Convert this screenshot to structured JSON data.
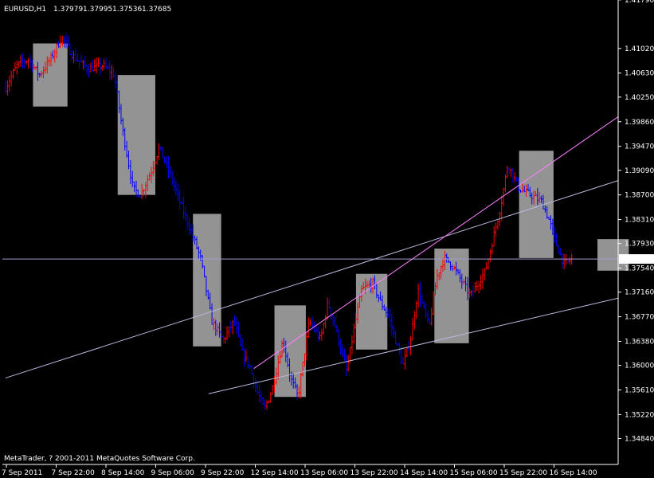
{
  "header": {
    "symbol": "EURUSD,H1",
    "open": "1.37979",
    "high": "1.37995",
    "low": "1.37536",
    "close": "1.37685"
  },
  "footer": {
    "copyright": "MetaTrader, ? 2001-2011 MetaQuotes Software Corp."
  },
  "colors": {
    "background": "#000000",
    "axis": "#ffffff",
    "up_bar": "#ff0000",
    "down_bar": "#0000ff",
    "zone": "#a0a0a0",
    "channel_line": "#b8b8e0",
    "pink_line": "#ff80ff",
    "price_line": "#a0a0d0"
  },
  "chart_data": {
    "type": "ohlc",
    "symbol": "EURUSD",
    "timeframe": "H1",
    "ylim": [
      1.3443,
      1.4175
    ],
    "y_ticks": [
      "1.41790",
      "1.41020",
      "1.40630",
      "1.40250",
      "1.39860",
      "1.39470",
      "1.39090",
      "1.38700",
      "1.38310",
      "1.37930",
      "1.37540",
      "1.37160",
      "1.36770",
      "1.36380",
      "1.36000",
      "1.35610",
      "1.35220",
      "1.34840"
    ],
    "x_ticks": [
      "7 Sep 2011",
      "7 Sep 22:00",
      "8 Sep 14:00",
      "9 Sep 06:00",
      "9 Sep 22:00",
      "12 Sep 14:00",
      "13 Sep 06:00",
      "13 Sep 22:00",
      "14 Sep 14:00",
      "15 Sep 06:00",
      "15 Sep 22:00",
      "16 Sep 14:00"
    ],
    "current_price": "1.37685",
    "path_anchors": [
      [
        0,
        1.404
      ],
      [
        6,
        1.4075
      ],
      [
        12,
        1.4085
      ],
      [
        18,
        1.406
      ],
      [
        24,
        1.4085
      ],
      [
        30,
        1.412
      ],
      [
        36,
        1.409
      ],
      [
        44,
        1.407
      ],
      [
        52,
        1.4075
      ],
      [
        58,
        1.406
      ],
      [
        62,
        1.398
      ],
      [
        68,
        1.388
      ],
      [
        72,
        1.387
      ],
      [
        78,
        1.391
      ],
      [
        82,
        1.3945
      ],
      [
        88,
        1.39
      ],
      [
        94,
        1.385
      ],
      [
        98,
        1.382
      ],
      [
        104,
        1.377
      ],
      [
        110,
        1.367
      ],
      [
        116,
        1.364
      ],
      [
        122,
        1.367
      ],
      [
        126,
        1.362
      ],
      [
        130,
        1.36
      ],
      [
        134,
        1.356
      ],
      [
        138,
        1.353
      ],
      [
        142,
        1.356
      ],
      [
        148,
        1.364
      ],
      [
        152,
        1.358
      ],
      [
        156,
        1.355
      ],
      [
        162,
        1.367
      ],
      [
        168,
        1.364
      ],
      [
        172,
        1.37
      ],
      [
        176,
        1.366
      ],
      [
        182,
        1.359
      ],
      [
        186,
        1.366
      ],
      [
        190,
        1.372
      ],
      [
        196,
        1.373
      ],
      [
        200,
        1.37
      ],
      [
        204,
        1.368
      ],
      [
        208,
        1.364
      ],
      [
        212,
        1.36
      ],
      [
        216,
        1.364
      ],
      [
        220,
        1.372
      ],
      [
        226,
        1.366
      ],
      [
        230,
        1.374
      ],
      [
        234,
        1.377
      ],
      [
        238,
        1.376
      ],
      [
        242,
        1.374
      ],
      [
        248,
        1.371
      ],
      [
        252,
        1.373
      ],
      [
        256,
        1.375
      ],
      [
        260,
        1.38
      ],
      [
        264,
        1.385
      ],
      [
        268,
        1.392
      ],
      [
        274,
        1.388
      ],
      [
        280,
        1.387
      ],
      [
        286,
        1.386
      ],
      [
        290,
        1.383
      ],
      [
        294,
        1.379
      ],
      [
        298,
        1.376
      ],
      [
        302,
        1.3768
      ]
    ],
    "zones": [
      {
        "from": 9,
        "to": 20,
        "low": 1.401,
        "high": 1.411
      },
      {
        "from": 36,
        "to": 48,
        "low": 1.387,
        "high": 1.406
      },
      {
        "from": 60,
        "to": 69,
        "low": 1.363,
        "high": 1.384
      },
      {
        "from": 86,
        "to": 96,
        "low": 1.355,
        "high": 1.3695
      },
      {
        "from": 112,
        "to": 122,
        "low": 1.3625,
        "high": 1.3745
      },
      {
        "from": 137,
        "to": 148,
        "low": 1.3635,
        "high": 1.3785
      },
      {
        "from": 164,
        "to": 175,
        "low": 1.377,
        "high": 1.394
      },
      {
        "from": 189,
        "to": 199,
        "low": 1.375,
        "high": 1.38
      }
    ],
    "trendlines": [
      {
        "kind": "channel",
        "p1": [
          0,
          1.358
        ],
        "p2": [
          302,
          1.387
        ]
      },
      {
        "kind": "channel",
        "p1": [
          108,
          1.3555
        ],
        "p2": [
          302,
          1.369
        ]
      },
      {
        "kind": "pink",
        "p1": [
          132,
          1.3595
        ],
        "p2": [
          302,
          1.3945
        ]
      }
    ]
  }
}
